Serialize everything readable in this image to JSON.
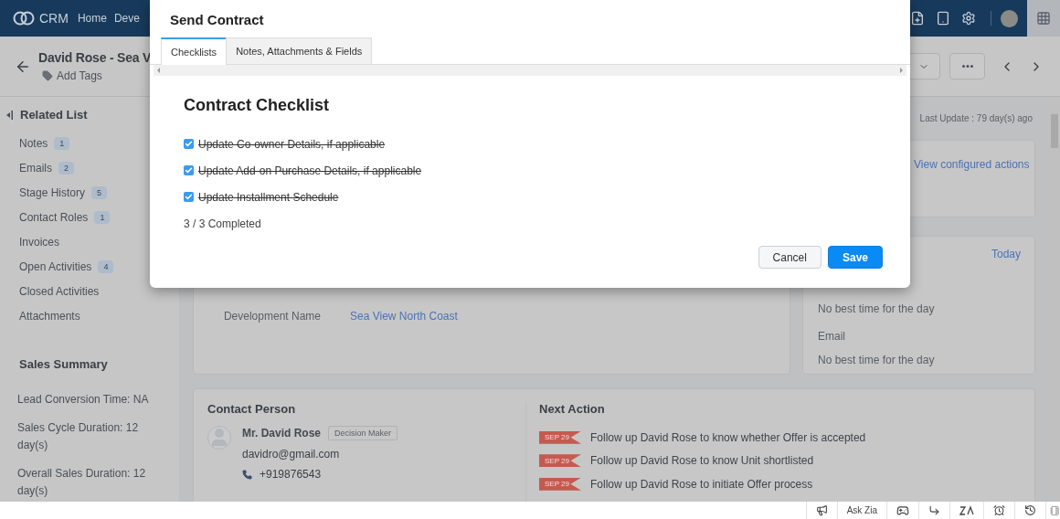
{
  "nav": {
    "logo": "CRM",
    "items": [
      {
        "label": "Home"
      },
      {
        "label": "Deve"
      }
    ]
  },
  "record": {
    "title": "David Rose - Sea V",
    "add_tags": "Add Tags"
  },
  "related_list": {
    "title": "Related List",
    "items": [
      {
        "label": "Notes",
        "count": "1"
      },
      {
        "label": "Emails",
        "count": "2"
      },
      {
        "label": "Stage History",
        "count": "5"
      },
      {
        "label": "Contact Roles",
        "count": "1"
      },
      {
        "label": "Invoices"
      },
      {
        "label": "Open Activities",
        "count": "4"
      },
      {
        "label": "Closed Activities"
      },
      {
        "label": "Attachments"
      }
    ]
  },
  "sales_summary": {
    "title": "Sales Summary",
    "items": [
      "Lead Conversion Time: NA",
      "Sales Cycle Duration: 12 day(s)",
      "Overall Sales Duration: 12 day(s)"
    ]
  },
  "last_update": "Last Update : 79 day(s) ago",
  "details": {
    "fields": [
      {
        "label": "Development Name",
        "value": "Sea View North Coast"
      }
    ]
  },
  "actions_card": {
    "link": "View configured actions"
  },
  "best_time": {
    "link": "Today",
    "entries": [
      {
        "value": "No best time for the day"
      },
      {
        "label": "Email",
        "value": "No best time for the day"
      }
    ]
  },
  "contact": {
    "title": "Contact Person",
    "name": "Mr. David Rose",
    "role": "Decision Maker",
    "email": "davidro@gmail.com",
    "phone": "+919876543"
  },
  "next_action": {
    "title": "Next Action",
    "items": [
      {
        "date": "SEP 29",
        "text": "Follow up David Rose to know whether Offer is accepted"
      },
      {
        "date": "SEP 29",
        "text": "Follow up David Rose to know Unit shortlisted"
      },
      {
        "date": "SEP 29",
        "text": "Follow up David Rose to initiate Offer process"
      }
    ]
  },
  "footer": {
    "ask_zia": "Ask Zia"
  },
  "modal": {
    "title": "Send Contract",
    "tabs": [
      {
        "label": "Checklists",
        "selected": true
      },
      {
        "label": "Notes, Attachments & Fields",
        "selected": false
      }
    ],
    "heading": "Contract Checklist",
    "checklist": [
      {
        "label": "Update Co-owner Details, if applicable",
        "checked": true
      },
      {
        "label": "Update Add-on Purchase Details, if applicable",
        "checked": true
      },
      {
        "label": "Update Installment Schedule",
        "checked": true
      }
    ],
    "progress": "3 / 3 Completed",
    "buttons": [
      {
        "label": "Cancel",
        "kind": "secondary"
      },
      {
        "label": "Save",
        "kind": "primary"
      }
    ]
  }
}
